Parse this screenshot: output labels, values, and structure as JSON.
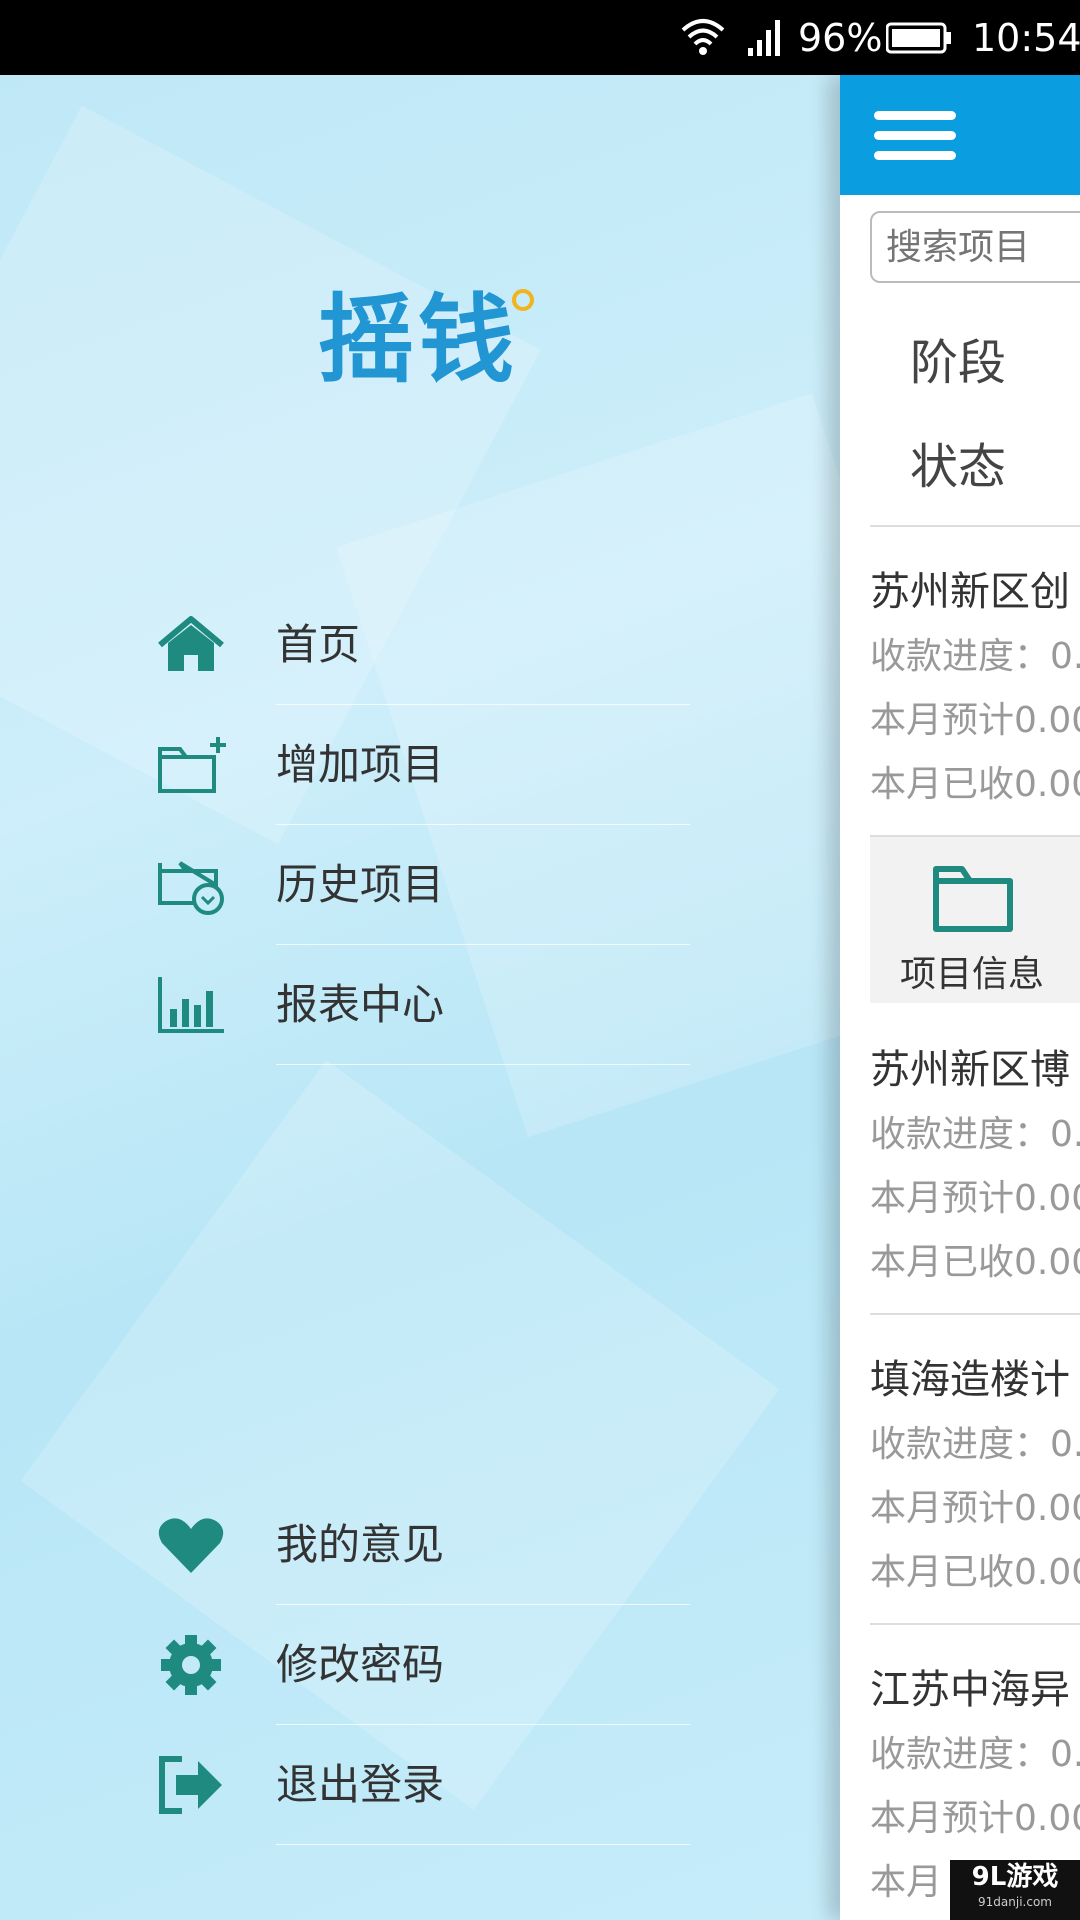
{
  "status_bar": {
    "battery_percent": "96%",
    "time": "10:54"
  },
  "drawer": {
    "logo_text": "摇钱",
    "menu_items": [
      {
        "label": "首页",
        "icon": "home-icon"
      },
      {
        "label": "增加项目",
        "icon": "folder-add-icon"
      },
      {
        "label": "历史项目",
        "icon": "folder-history-icon"
      },
      {
        "label": "报表中心",
        "icon": "bar-chart-icon"
      }
    ],
    "bottom_items": [
      {
        "label": "我的意见",
        "icon": "heart-icon"
      },
      {
        "label": "修改密码",
        "icon": "gear-icon"
      },
      {
        "label": "退出登录",
        "icon": "logout-icon"
      }
    ]
  },
  "main": {
    "search_placeholder": "搜索项目",
    "filters": [
      "阶段",
      "状态"
    ],
    "projects": [
      {
        "title": "苏州新区创",
        "progress": "收款进度：0.",
        "month_expected": "本月预计0.00",
        "month_received": "本月已收0.00"
      },
      {
        "title": "苏州新区博",
        "progress": "收款进度：0.",
        "month_expected": "本月预计0.00",
        "month_received": "本月已收0.00"
      },
      {
        "title": "填海造楼计",
        "progress": "收款进度：0.",
        "month_expected": "本月预计0.00",
        "month_received": "本月已收0.00"
      },
      {
        "title": "江苏中海异",
        "progress": "收款进度：0.",
        "month_expected": "本月预计0.00",
        "month_received": "本月"
      }
    ],
    "info_action_label": "项目信息"
  },
  "watermark": {
    "main": "9L游戏",
    "sub": "91danji.com"
  },
  "colors": {
    "accent": "#0a9de0",
    "icon_teal": "#1f8a80",
    "drawer_bg": "#c4eaf8"
  }
}
